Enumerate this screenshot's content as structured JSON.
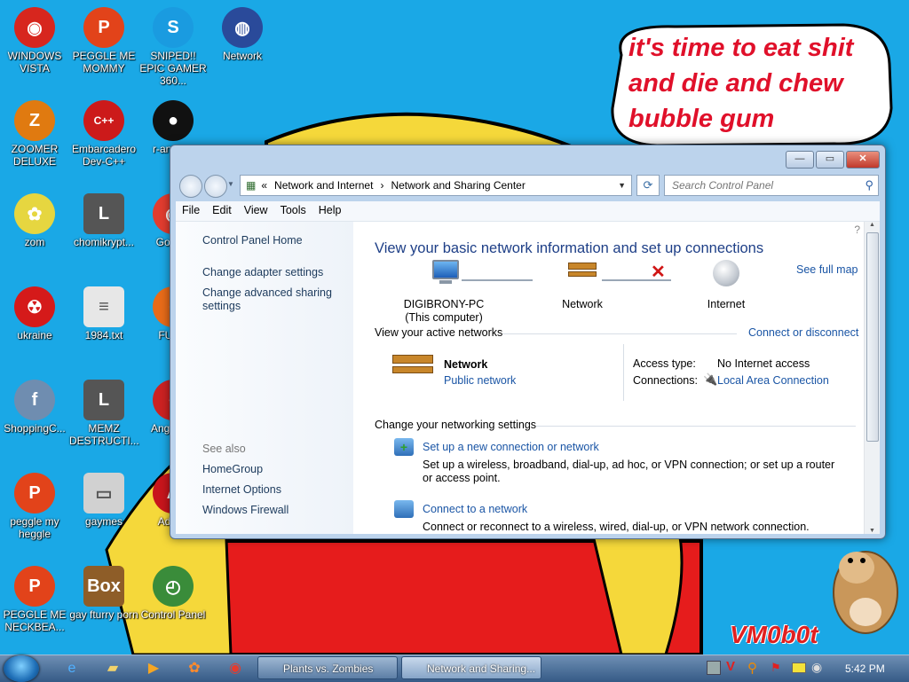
{
  "desktop": {
    "speech_text": "it's time to eat shit and die and chew bubble gum",
    "signature": "VM0b0t",
    "icons": [
      {
        "label": "WINDOWS VISTA",
        "icon": "vista-app-icon",
        "color": "#d7261e"
      },
      {
        "label": "PEGGLE ME MOMMY",
        "icon": "peggle-icon",
        "color": "#e2431a"
      },
      {
        "label": "SNIPED!! EPIC GAMER 360...",
        "icon": "skype-icon",
        "color": "#1a9be0"
      },
      {
        "label": "Network",
        "icon": "network-globe-icon",
        "color": "#2a4a9a"
      },
      {
        "label": "ZOOMER DELUXE",
        "icon": "zoomer-icon",
        "color": "#e07a10"
      },
      {
        "label": "Embarcadero Dev-C++",
        "icon": "devcpp-icon",
        "color": "#cc1a1a"
      },
      {
        "label": "r-an parr",
        "icon": "red-orb-icon",
        "color": "#111111"
      },
      {
        "label": "zom",
        "icon": "flower-icon",
        "color": "#e6d640"
      },
      {
        "label": "chomikrypt...",
        "icon": "clock-icon",
        "color": "#555555"
      },
      {
        "label": "Go Chr",
        "icon": "chrome-icon",
        "color": "#e23c2f"
      },
      {
        "label": "ukraine",
        "icon": "radiation-icon",
        "color": "#d51a1a"
      },
      {
        "label": "1984.txt",
        "icon": "text-file-icon",
        "color": "#e7e7e7"
      },
      {
        "label": "FURR",
        "icon": "firefox-icon",
        "color": "#e86b19"
      },
      {
        "label": "ShoppingC...",
        "icon": "flash-icon",
        "color": "#6f8db0"
      },
      {
        "label": "MEMZ DESTRUCTI...",
        "icon": "clock-icon",
        "color": "#555555"
      },
      {
        "label": "Angr Sea",
        "icon": "angry-birds-icon",
        "color": "#cc2222"
      },
      {
        "label": "peggle my heggle",
        "icon": "peggle-icon",
        "color": "#e2431a"
      },
      {
        "label": "gaymes",
        "icon": "folder-icon",
        "color": "#d1d1d1"
      },
      {
        "label": "Adobe",
        "icon": "adobe-icon",
        "color": "#c8151c"
      },
      {
        "label": "PEGGLE ME NECKBEA...",
        "icon": "peggle-icon",
        "color": "#e2431a"
      },
      {
        "label": "gay fturry porn",
        "icon": "gopher-box-icon",
        "color": "#8e5d28"
      },
      {
        "label": "Control Panel",
        "icon": "control-panel-icon",
        "color": "#3a8c3a"
      }
    ]
  },
  "window": {
    "title_buttons": {
      "minimize": "—",
      "maximize": "▭",
      "close": "✕"
    },
    "address": {
      "prefix": "«",
      "crumb1": "Network and Internet",
      "sep": "›",
      "crumb2": "Network and Sharing Center"
    },
    "refresh_symbol": "⟳",
    "search_placeholder": "Search Control Panel",
    "menu": [
      "File",
      "Edit",
      "View",
      "Tools",
      "Help"
    ],
    "left_nav": {
      "home": "Control Panel Home",
      "adapter": "Change adapter settings",
      "advanced": "Change advanced sharing settings",
      "see_also": "See also",
      "homegroup": "HomeGroup",
      "internet_options": "Internet Options",
      "firewall": "Windows Firewall"
    },
    "main": {
      "heading": "View your basic network information and set up connections",
      "see_full_map": "See full map",
      "computer_name": "DIGIBRONY-PC",
      "computer_sub": "(This computer)",
      "network_label": "Network",
      "internet_label": "Internet",
      "active_title": "View your active networks",
      "connect_disconnect": "Connect or disconnect",
      "active_name": "Network",
      "active_type": "Public network",
      "access_type_label": "Access type:",
      "access_type_value": "No Internet access",
      "connections_label": "Connections:",
      "connections_value": "Local Area Connection",
      "change_title": "Change your networking settings",
      "setup_link": "Set up a new connection or network",
      "setup_desc": "Set up a wireless, broadband, dial-up, ad hoc, or VPN connection; or set up a router or access point.",
      "connect_link": "Connect to a network",
      "connect_desc": "Connect or reconnect to a wireless, wired, dial-up, or VPN network connection."
    }
  },
  "taskbar": {
    "buttons": [
      {
        "label": "Plants vs. Zombies",
        "active": false
      },
      {
        "label": "Network and Sharing...",
        "active": true
      }
    ],
    "clock": "5:42 PM"
  }
}
